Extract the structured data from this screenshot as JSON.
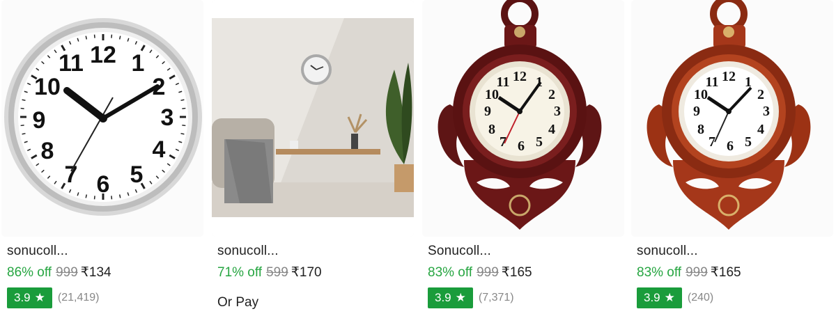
{
  "products": [
    {
      "name": "sonucoll...",
      "discount": "86% off",
      "mrp": "999",
      "price": "₹134",
      "rating": "3.9",
      "rating_count": "(21,419)",
      "image": "silver-wall-clock"
    },
    {
      "name": "sonucoll...",
      "discount": "71% off",
      "mrp": "599",
      "price": "₹170",
      "extra": "Or Pay",
      "image": "room-with-wall-clock"
    },
    {
      "name": "Sonucoll...",
      "discount": "83% off",
      "mrp": "999",
      "price": "₹165",
      "rating": "3.9",
      "rating_count": "(7,371)",
      "image": "dark-anchor-clock"
    },
    {
      "name": "sonucoll...",
      "discount": "83% off",
      "mrp": "999",
      "price": "₹165",
      "rating": "3.9",
      "rating_count": "(240)",
      "image": "brown-anchor-clock"
    }
  ],
  "icons": {
    "rating": "star-icon"
  },
  "colors": {
    "discount": "#26a541",
    "rating_badge": "#1a9c3b",
    "mrp": "#878787"
  }
}
